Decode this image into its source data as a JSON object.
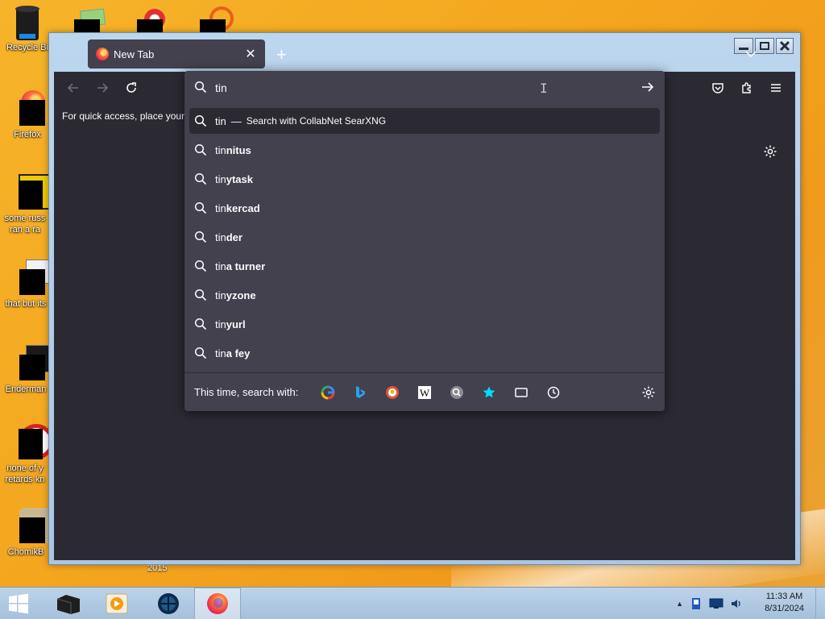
{
  "desktop": {
    "icons": [
      {
        "label": "Recycle Bi",
        "name": "desktop-icon-recycle-bin"
      },
      {
        "label": "Firefox",
        "name": "desktop-icon-firefox"
      },
      {
        "label": "some russ ran a ra",
        "name": "desktop-icon-some-russ"
      },
      {
        "label": "that but its",
        "name": "desktop-icon-that-but-its"
      },
      {
        "label": "Enderman",
        "name": "desktop-icon-enderman"
      },
      {
        "label": "none of y retards kn",
        "name": "desktop-icon-none-of-y"
      },
      {
        "label": "ChomikB",
        "name": "desktop-icon-chomikb"
      }
    ],
    "partial_label": "2015"
  },
  "browser": {
    "tab_title": "New Tab",
    "bookmarks_text": "For quick access, place your bookmarks here on the bookmarks toolbar."
  },
  "urlbar": {
    "value": "tin",
    "first_row": {
      "typed": "tin",
      "dash": "—",
      "action": "Search with CollabNet SearXNG"
    },
    "suggestions": [
      {
        "typed": "tin",
        "rest": "nitus"
      },
      {
        "typed": "tin",
        "rest": "ytask"
      },
      {
        "typed": "tin",
        "rest": "kercad"
      },
      {
        "typed": "tin",
        "rest": "der"
      },
      {
        "typed": "tin",
        "rest": "a turner"
      },
      {
        "typed": "tin",
        "rest": "yzone"
      },
      {
        "typed": "tin",
        "rest": "yurl"
      },
      {
        "typed": "tin",
        "rest": "a fey"
      }
    ],
    "one_off_label": "This time, search with:",
    "engines": [
      "google-icon",
      "bing-icon",
      "duckduckgo-icon",
      "wikipedia-icon",
      "searxng-icon",
      "bookmarks-star-icon",
      "tabs-icon",
      "history-icon"
    ]
  },
  "clock": {
    "time": "11:33 AM",
    "date": "8/31/2024"
  },
  "colors": {
    "toolbar_bg": "#2b2a33",
    "popup_bg": "#42414d",
    "text": "#fbfbfe",
    "accent_cyan": "#00ddff"
  }
}
